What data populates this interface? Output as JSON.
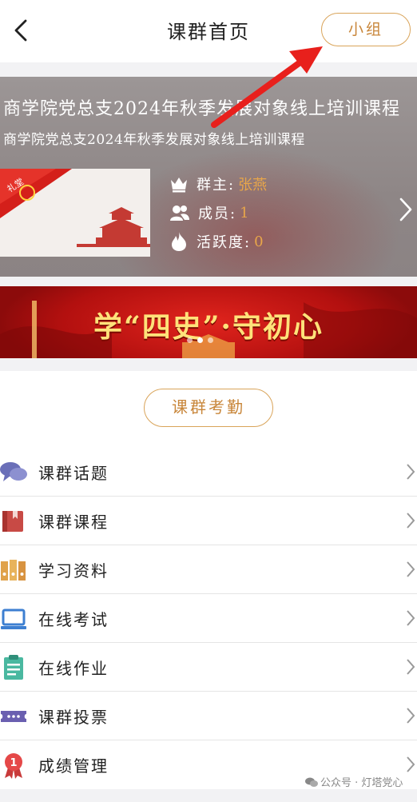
{
  "header": {
    "title": "课群首页",
    "group_button": "小组"
  },
  "course": {
    "title": "商学院党总支2024年秋季发展对象线上培训课程",
    "subtitle": "商学院党总支2024年秋季发展对象线上培训课程",
    "cover_badge": "礼堂",
    "owner_label": "群主:",
    "owner_value": "张燕",
    "members_label": "成员:",
    "members_value": "1",
    "activity_label": "活跃度:",
    "activity_value": "0"
  },
  "banner": {
    "text": "学“四史”·守初心",
    "slides": 3,
    "active_slide": 1
  },
  "attendance_button": "课群考勤",
  "menu": [
    {
      "label": "课群话题",
      "icon": "chat-bubbles-icon"
    },
    {
      "label": "课群课程",
      "icon": "book-icon"
    },
    {
      "label": "学习资料",
      "icon": "binders-icon"
    },
    {
      "label": "在线考试",
      "icon": "laptop-icon"
    },
    {
      "label": "在线作业",
      "icon": "clipboard-icon"
    },
    {
      "label": "课群投票",
      "icon": "ticket-icon"
    },
    {
      "label": "成绩管理",
      "icon": "medal-icon"
    }
  ],
  "watermark": "公众号 · 灯塔党心",
  "colors": {
    "accent": "#c8863a",
    "accent_border": "#d9a45a",
    "value_orange": "#e8a64a",
    "annotation_arrow": "#e8201c"
  }
}
